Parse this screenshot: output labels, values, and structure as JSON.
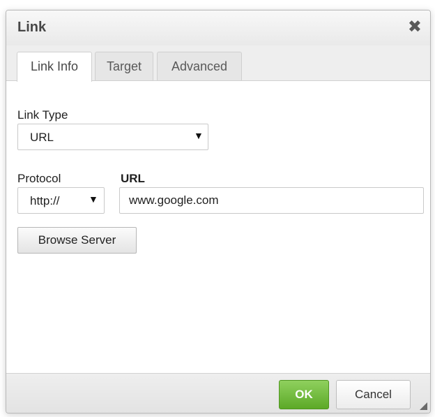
{
  "dialog": {
    "title": "Link",
    "close_glyph": "✖"
  },
  "tabs": [
    {
      "label": "Link Info",
      "active": true
    },
    {
      "label": "Target",
      "active": false
    },
    {
      "label": "Advanced",
      "active": false
    }
  ],
  "form": {
    "link_type": {
      "label": "Link Type",
      "value": "URL"
    },
    "protocol": {
      "label": "Protocol",
      "value": "http://"
    },
    "url": {
      "label": "URL",
      "value": "www.google.com"
    },
    "browse_label": "Browse Server",
    "dropdown_glyph": "▼"
  },
  "footer": {
    "ok_label": "OK",
    "cancel_label": "Cancel"
  },
  "colors": {
    "ok_button": "#5ca927",
    "title_text": "#474747"
  },
  "icons": {
    "close": "close-icon",
    "dropdown": "chevron-down-icon",
    "resize": "resize-grip-icon"
  }
}
